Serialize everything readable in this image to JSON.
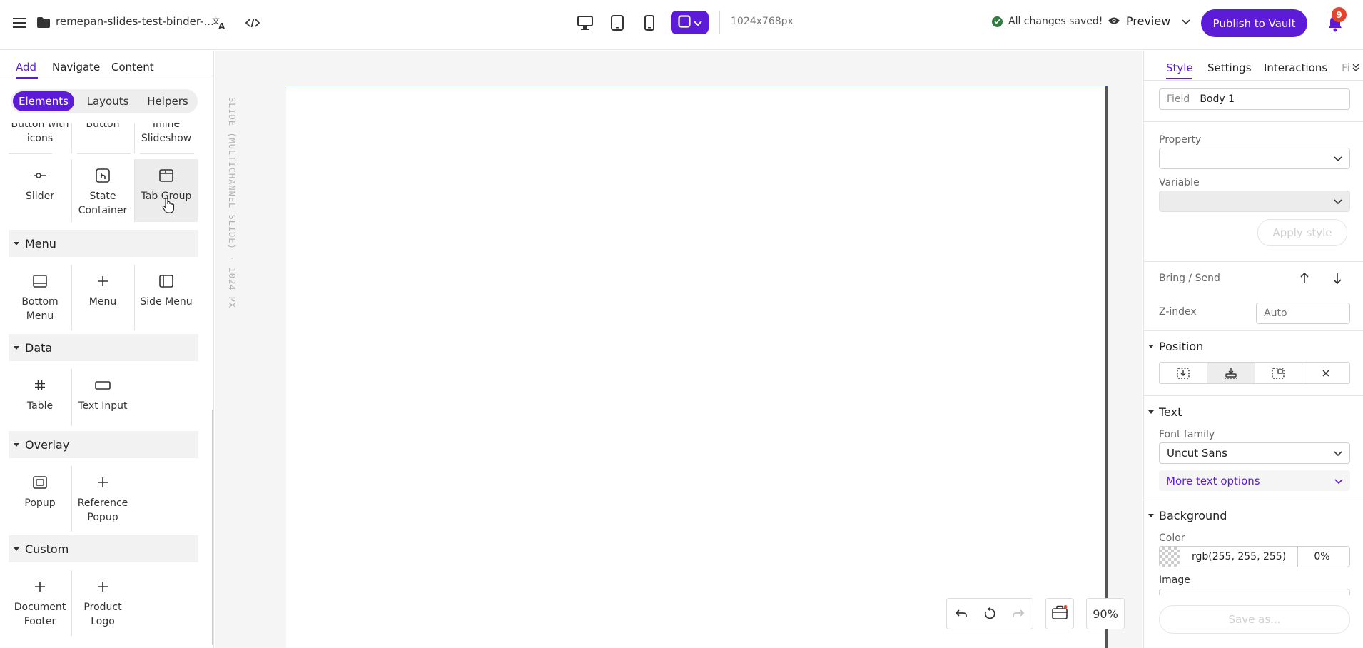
{
  "topbar": {
    "project_name": "remepan-slides-test-binder-...",
    "dimensions": "1024x768px",
    "save_status": "All changes saved!",
    "preview_label": "Preview",
    "publish_label": "Publish to Vault",
    "notification_count": "9",
    "device_icons": [
      "desktop-icon",
      "tablet-icon",
      "mobile-icon",
      "custom-size-icon"
    ]
  },
  "left": {
    "tabs": [
      "Add",
      "Navigate",
      "Content"
    ],
    "active_tab": "Add",
    "segments": [
      "Elements",
      "Layouts",
      "Helpers"
    ],
    "active_segment": "Elements",
    "top_row": [
      "Button with icons",
      "Button",
      "Inline Slideshow"
    ],
    "row_items": [
      "Slider",
      "State Container",
      "Tab Group"
    ],
    "hover_item": "Tab Group",
    "sections": {
      "menu": {
        "title": "Menu",
        "items": [
          "Bottom Menu",
          "Menu",
          "Side Menu"
        ]
      },
      "data": {
        "title": "Data",
        "items": [
          "Table",
          "Text Input"
        ]
      },
      "overlay": {
        "title": "Overlay",
        "items": [
          "Popup",
          "Reference Popup"
        ]
      },
      "custom": {
        "title": "Custom",
        "items": [
          "Document Footer",
          "Product Logo"
        ]
      }
    }
  },
  "canvas": {
    "slide_label": "SLIDE (MULTICHANNEL SLIDE) · 1024 PX",
    "zoom": "90%"
  },
  "right": {
    "tabs": [
      "Style",
      "Settings",
      "Interactions",
      "Fi"
    ],
    "active_tab": "Style",
    "field_label": "Field",
    "field_value": "Body 1",
    "property_label": "Property",
    "property_value": "",
    "variable_label": "Variable",
    "variable_value": "",
    "apply_style": "Apply style",
    "bring_send": "Bring / Send",
    "zindex_label": "Z-index",
    "zindex_placeholder": "Auto",
    "position_title": "Position",
    "text_title": "Text",
    "font_family_label": "Font family",
    "font_family_value": "Uncut Sans",
    "more_text_options": "More text options",
    "background_title": "Background",
    "color_label": "Color",
    "color_value": "rgb(255, 255, 255)",
    "color_opacity": "0%",
    "image_label": "Image",
    "save_as": "Save as..."
  },
  "colors": {
    "accent": "#5c1bd6",
    "saved_ok": "#2f7d3e",
    "badge": "#e0452f"
  }
}
